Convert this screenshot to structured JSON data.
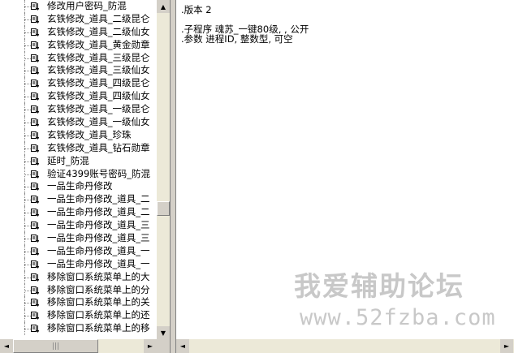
{
  "tree": {
    "items": [
      {
        "label": "修改用户密码_防混",
        "selected": true
      },
      {
        "label": "玄铁修改_道具_二级昆仑"
      },
      {
        "label": "玄铁修改_道具_二级仙女"
      },
      {
        "label": "玄铁修改_道具_黄金勋章"
      },
      {
        "label": "玄铁修改_道具_三级昆仑"
      },
      {
        "label": "玄铁修改_道具_三级仙女"
      },
      {
        "label": "玄铁修改_道具_四级昆仑"
      },
      {
        "label": "玄铁修改_道具_四级仙女"
      },
      {
        "label": "玄铁修改_道具_一级昆仑"
      },
      {
        "label": "玄铁修改_道具_一级仙女"
      },
      {
        "label": "玄铁修改_道具_珍珠"
      },
      {
        "label": "玄铁修改_道具_钻石勋章"
      },
      {
        "label": "延时_防混"
      },
      {
        "label": "验证4399账号密码_防混"
      },
      {
        "label": "一品生命丹修改"
      },
      {
        "label": "一品生命丹修改_道具_二"
      },
      {
        "label": "一品生命丹修改_道具_二"
      },
      {
        "label": "一品生命丹修改_道具_三"
      },
      {
        "label": "一品生命丹修改_道具_三"
      },
      {
        "label": "一品生命丹修改_道具_一"
      },
      {
        "label": "一品生命丹修改_道具_一"
      },
      {
        "label": "移除窗口系统菜单上的大"
      },
      {
        "label": "移除窗口系统菜单上的分"
      },
      {
        "label": "移除窗口系统菜单上的关"
      },
      {
        "label": "移除窗口系统菜单上的还"
      },
      {
        "label": "移除窗口系统菜单上的移"
      }
    ],
    "scroll_up": "▲",
    "scroll_down": "▼",
    "scroll_left": "◄",
    "scroll_right": "►",
    "thumb_grip": "|||"
  },
  "editor": {
    "lines": [
      {
        "text": ".版本 2"
      },
      {
        "text": ""
      },
      {
        "text": ".子程序 魂苏_一键80级, , 公开"
      },
      {
        "text": ".参数 进程ID, 整数型, 可空"
      }
    ],
    "scroll_left": "◄",
    "scroll_right": "►"
  },
  "watermark": {
    "title": "我爱辅助论坛",
    "url": "www.52fzba.com"
  },
  "colors": {
    "panel_bg": "#d4d0c8",
    "editor_bg": "#ffffff",
    "watermark": "#c8c8c8"
  }
}
